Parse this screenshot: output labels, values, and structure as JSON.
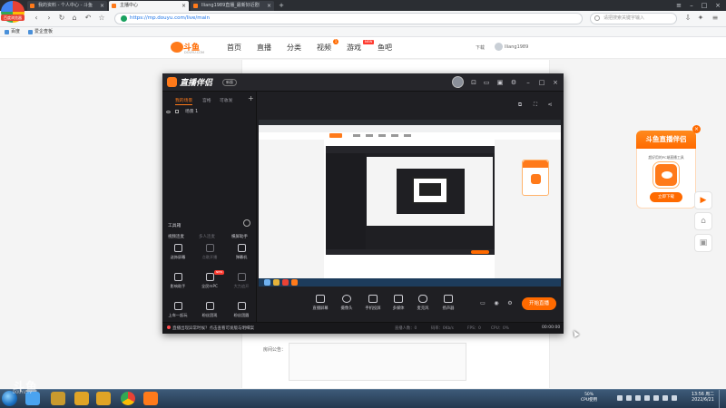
{
  "browser": {
    "logo_label": "百度浏览器",
    "tabs": [
      {
        "title": "我的资料 - 个人中心 - 斗鱼",
        "active": false
      },
      {
        "title": "主播中心",
        "active": true
      },
      {
        "title": "lliang1989直播_最新好近剧",
        "active": false
      }
    ],
    "url": "https://mp.douyu.com/live/main",
    "search_placeholder": "请把搜索关键字输入",
    "bookmarks": [
      "百度",
      "爱企查板"
    ]
  },
  "site": {
    "logo_text": "斗鱼",
    "logo_sub": "DOUYU.COM",
    "nav": [
      {
        "label": "首页"
      },
      {
        "label": "直播"
      },
      {
        "label": "分类"
      },
      {
        "label": "视频",
        "badge": "1"
      },
      {
        "label": "游戏",
        "badge": "NEW"
      },
      {
        "label": "鱼吧"
      }
    ],
    "download": "下载",
    "username": "lliang1989",
    "notice_label": "房间公告："
  },
  "promo": {
    "title": "斗鱼直播伴侣",
    "desc": "超好用的PC端直播工具",
    "button": "立即下载",
    "close": "×"
  },
  "side_buttons": [
    "▶",
    "⌂",
    "▣"
  ],
  "companion": {
    "title": "直播伴侣",
    "version": "新版",
    "scene_tabs": [
      "我的场景",
      "宫格",
      "可收发"
    ],
    "scene_name": "场景 1",
    "toolbox_label": "工具箱",
    "tool_links": [
      {
        "label": "视频连麦",
        "dim": false
      },
      {
        "label": "多人连麦",
        "dim": true
      },
      {
        "label": "横屏助手",
        "dim": false
      }
    ],
    "tools": [
      {
        "label": "送饰屏幕",
        "dim": false
      },
      {
        "label": "点歌开播",
        "dim": true
      },
      {
        "label": "弹幕机",
        "dim": false
      },
      {
        "label": "影响助手",
        "dim": false
      },
      {
        "label": "全民mPC",
        "dim": false,
        "badge": "NEW"
      },
      {
        "label": "大力追开",
        "dim": true
      },
      {
        "label": "上车一起玩",
        "dim": false
      },
      {
        "label": "粉丝团观",
        "dim": false
      },
      {
        "label": "粉丝团圆",
        "dim": false
      }
    ],
    "bottom_tools": [
      "直播屏幕",
      "摄像头",
      "手机投屏",
      "多媒体",
      "麦克风",
      "扬声器"
    ],
    "start_live": "开始直播",
    "status_tip": "直播出现异常时候？点击查看可发版与明细案",
    "stats": [
      "直播人数：0",
      "码率：0Kb/s",
      "FPS：0",
      "CPU：0%"
    ],
    "status_time": "00:00:00"
  },
  "watermark": {
    "main": "斗鱼",
    "sub": "DOUYU.TV"
  },
  "taskbar": {
    "cpu_line1": "50%",
    "cpu_line2": "CPU使用",
    "clock_time": "13:56 周二",
    "clock_date": "2022/6/21"
  },
  "colors": {
    "brand_orange": "#ff6a00",
    "app_bg": "#1f1f23",
    "taskbar": "#24384f"
  }
}
